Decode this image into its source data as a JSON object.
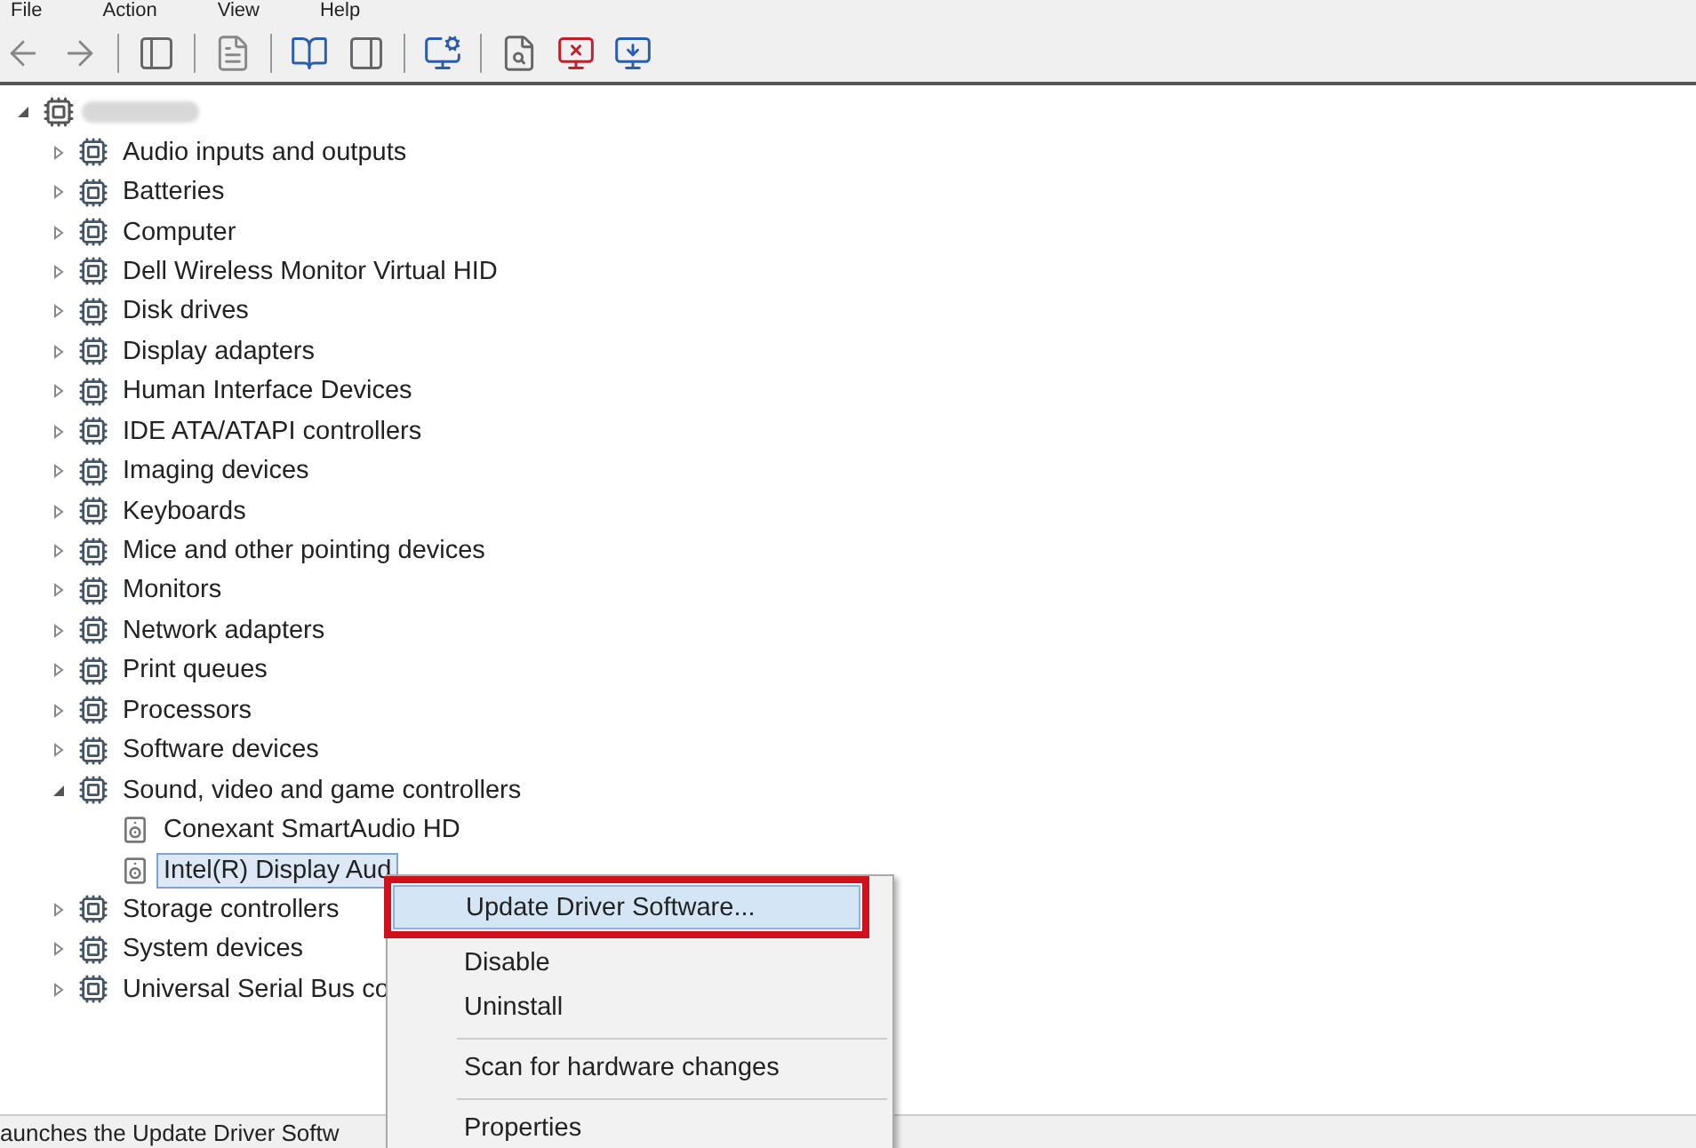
{
  "menu_bar": [
    "File",
    "Action",
    "View",
    "Help"
  ],
  "tree": {
    "root_expanded": true,
    "items": [
      {
        "label": "Audio inputs and outputs",
        "expanded": false
      },
      {
        "label": "Batteries",
        "expanded": false
      },
      {
        "label": "Computer",
        "expanded": false
      },
      {
        "label": "Dell Wireless Monitor Virtual HID",
        "expanded": false
      },
      {
        "label": "Disk drives",
        "expanded": false
      },
      {
        "label": "Display adapters",
        "expanded": false
      },
      {
        "label": "Human Interface Devices",
        "expanded": false
      },
      {
        "label": "IDE ATA/ATAPI controllers",
        "expanded": false
      },
      {
        "label": "Imaging devices",
        "expanded": false
      },
      {
        "label": "Keyboards",
        "expanded": false
      },
      {
        "label": "Mice and other pointing devices",
        "expanded": false
      },
      {
        "label": "Monitors",
        "expanded": false
      },
      {
        "label": "Network adapters",
        "expanded": false
      },
      {
        "label": "Print queues",
        "expanded": false
      },
      {
        "label": "Processors",
        "expanded": false
      },
      {
        "label": "Software devices",
        "expanded": false
      },
      {
        "label": "Sound, video and game controllers",
        "expanded": true,
        "children": [
          {
            "label": "Conexant SmartAudio HD",
            "selected": false
          },
          {
            "label": "Intel(R) Display Aud",
            "selected": true
          }
        ]
      },
      {
        "label": "Storage controllers",
        "expanded": false
      },
      {
        "label": "System devices",
        "expanded": false
      },
      {
        "label": "Universal Serial Bus co",
        "expanded": false
      }
    ]
  },
  "context_menu": [
    {
      "label": "Update Driver Software...",
      "highlighted": true,
      "separator_before": false
    },
    {
      "label": "Disable",
      "highlighted": false,
      "separator_before": false
    },
    {
      "label": "Uninstall",
      "highlighted": false,
      "separator_before": false
    },
    {
      "label": "Scan for hardware changes",
      "highlighted": false,
      "separator_before": true
    },
    {
      "label": "Properties",
      "highlighted": false,
      "separator_before": true
    }
  ],
  "status_bar": "aunches the Update Driver Softw"
}
